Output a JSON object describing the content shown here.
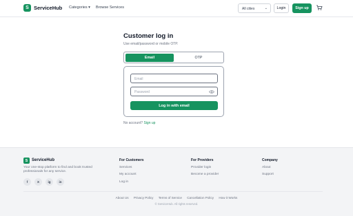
{
  "header": {
    "logo_letter": "S",
    "brand": "ServiceHub",
    "nav_categories": "Categories",
    "nav_browse": "Browse Services",
    "city_select": "All cities",
    "login": "Login",
    "signup": "Sign up"
  },
  "login": {
    "title": "Customer log in",
    "subtitle": "Use email/password or mobile OTP.",
    "tabs": [
      "Email",
      "OTP"
    ],
    "email_placeholder": "Email",
    "password_placeholder": "Password",
    "submit": "Log in with email",
    "no_account": "No account?",
    "signup_link": "Sign up"
  },
  "footer": {
    "logo_letter": "S",
    "brand": "ServiceHub",
    "tagline": "Your one-stop platform to find and book trusted professionals for any service.",
    "social": [
      "f",
      "X",
      "ig",
      "in"
    ],
    "columns": [
      {
        "heading": "For Customers",
        "links": [
          "Services",
          "My account",
          "Log in"
        ]
      },
      {
        "heading": "For Providers",
        "links": [
          "Provider login",
          "Become a provider"
        ]
      },
      {
        "heading": "Company",
        "links": [
          "About",
          "Support"
        ]
      }
    ],
    "bottom_links": [
      "About Us",
      "Privacy Policy",
      "Terms of Service",
      "Cancellation Policy",
      "How it Works"
    ],
    "copyright": "© ServiceHub. All rights reserved."
  },
  "colors": {
    "accent": "#16935f",
    "footer_bg": "#f3f4f6"
  }
}
